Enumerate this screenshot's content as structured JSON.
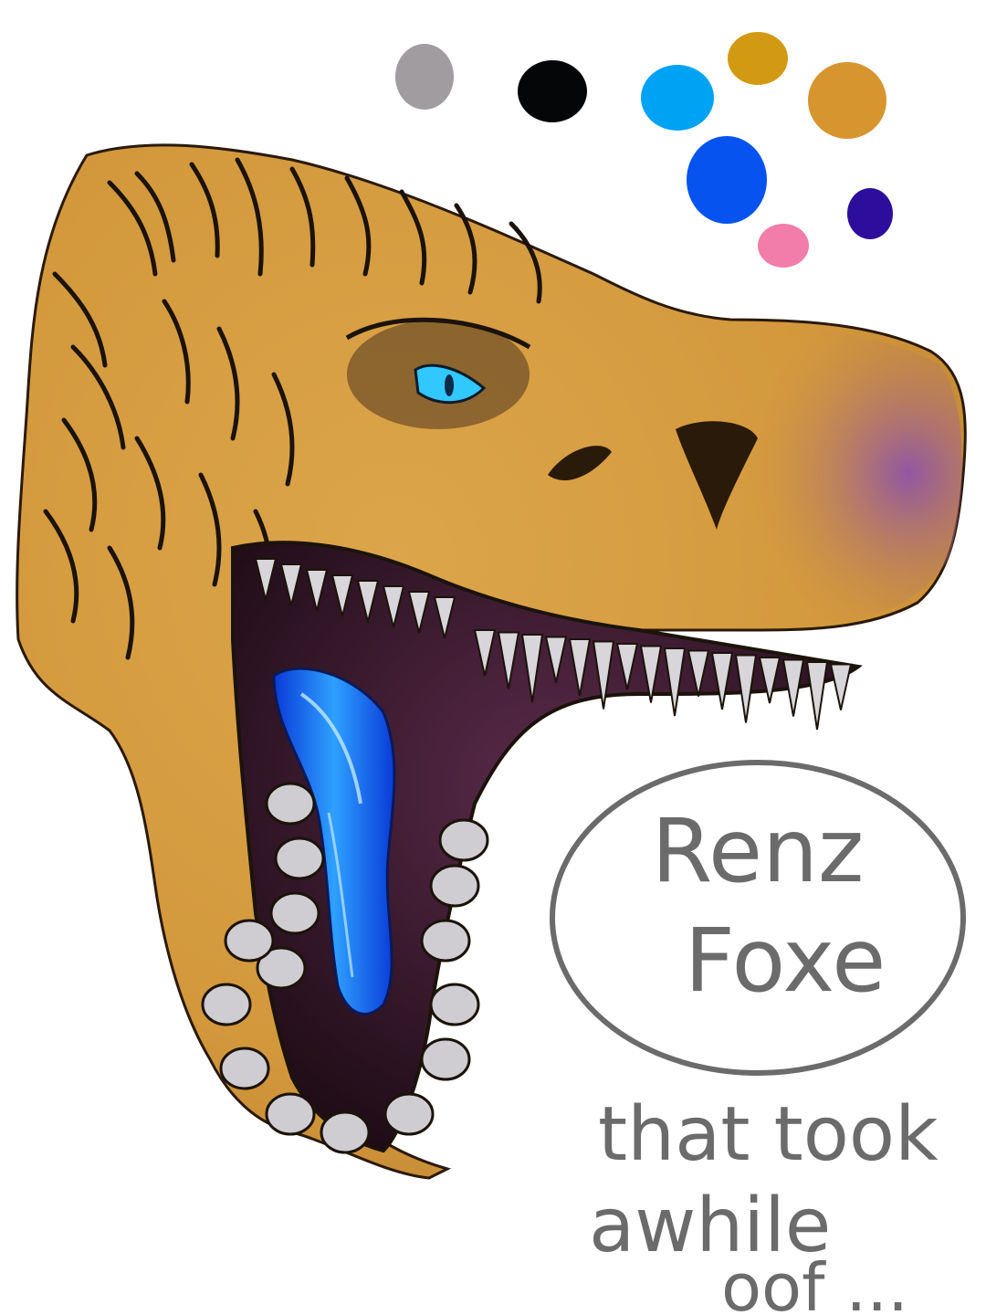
{
  "artwork": {
    "signature_name_line1": "Renz",
    "signature_name_line2": "Foxe",
    "caption_line1": "that took",
    "caption_line2": "awhile",
    "caption_line3": "oof ..."
  },
  "palette": {
    "swatches": [
      {
        "name": "gray",
        "color": "#a09ca0"
      },
      {
        "name": "black",
        "color": "#050608"
      },
      {
        "name": "sky-blue",
        "color": "#00a3f3"
      },
      {
        "name": "gold",
        "color": "#d29a12"
      },
      {
        "name": "orange-tan",
        "color": "#d7952f"
      },
      {
        "name": "royal-blue",
        "color": "#0753ef"
      },
      {
        "name": "indigo",
        "color": "#2d0e9c"
      },
      {
        "name": "pink",
        "color": "#f27daa"
      }
    ]
  },
  "colors": {
    "skin": "#d59b3f",
    "skin_dark": "#b27a2b",
    "snout_purple": "#8a56a8",
    "mouth": "#2a1020",
    "tongue": "#1a7cff",
    "eye": "#30c8ff",
    "teeth": "#d8d6da",
    "ink": "#1b130a",
    "text": "#6b6b6b"
  }
}
